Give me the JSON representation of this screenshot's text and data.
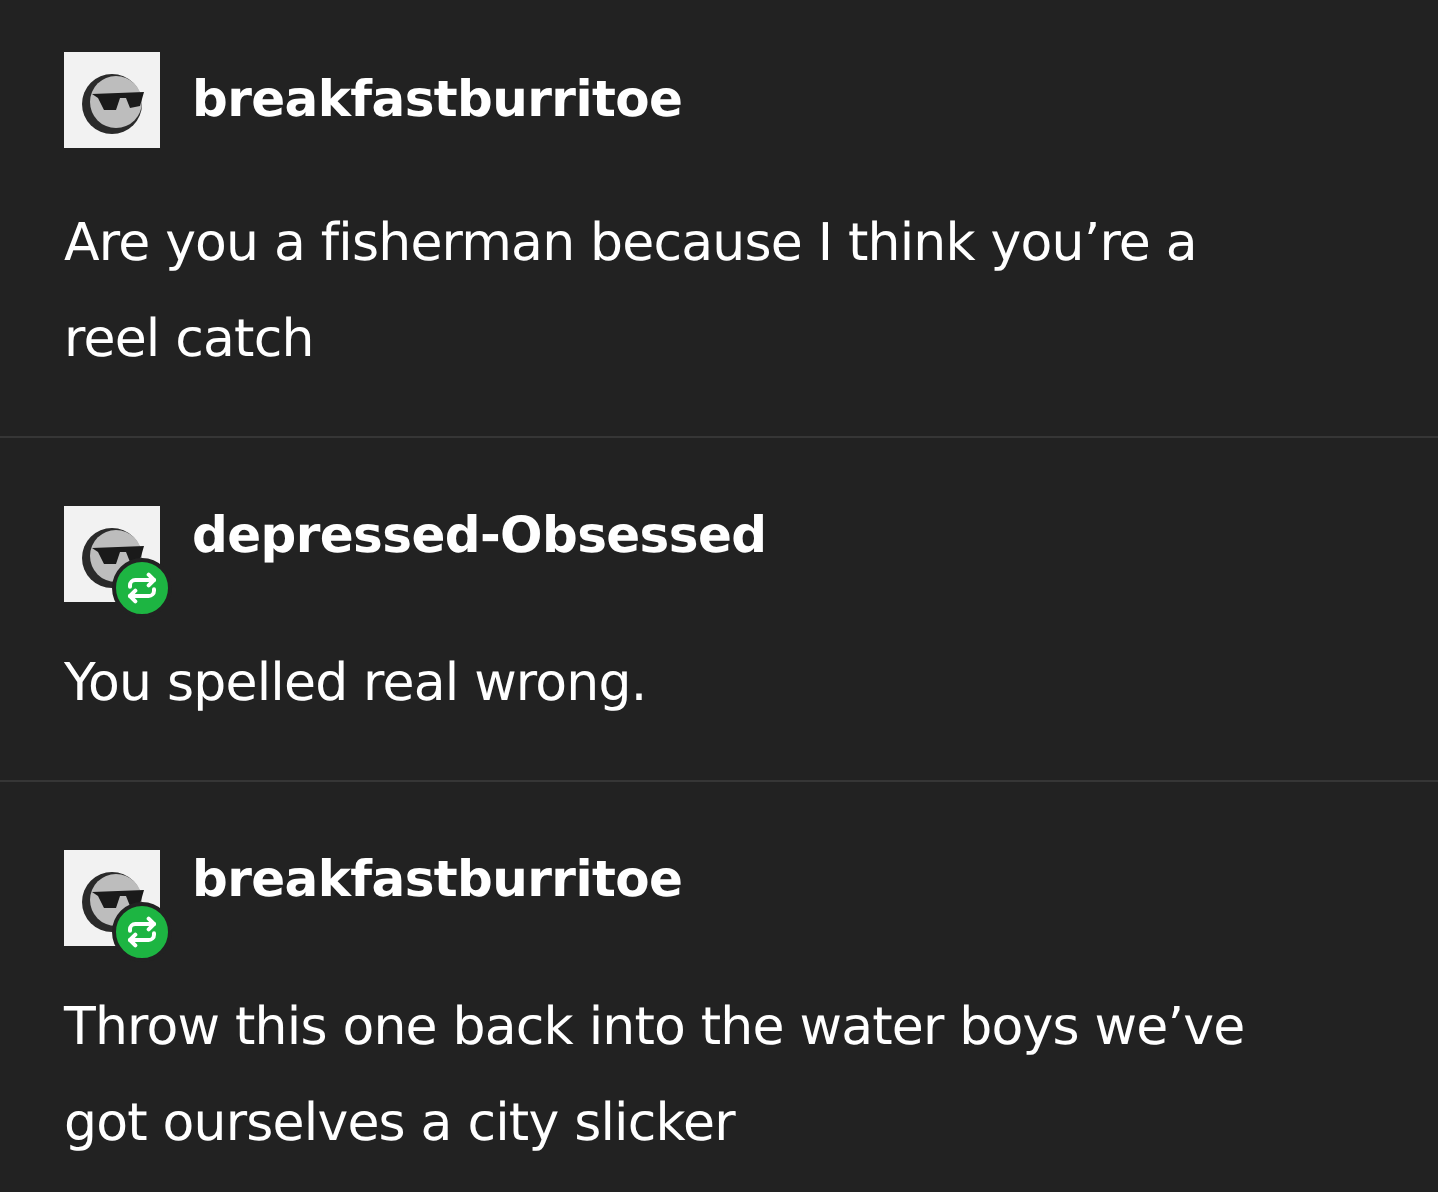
{
  "posts": [
    {
      "username": "breakfastburritoe",
      "reblogged": false,
      "text": "Are you a fisherman because I think you’re a reel catch"
    },
    {
      "username": "depressed-Obsessed",
      "reblogged": true,
      "text": "You spelled real wrong."
    },
    {
      "username": "breakfastburritoe",
      "reblogged": true,
      "text": "Throw this one back into the water boys we’ve got ourselves a city slicker"
    }
  ]
}
